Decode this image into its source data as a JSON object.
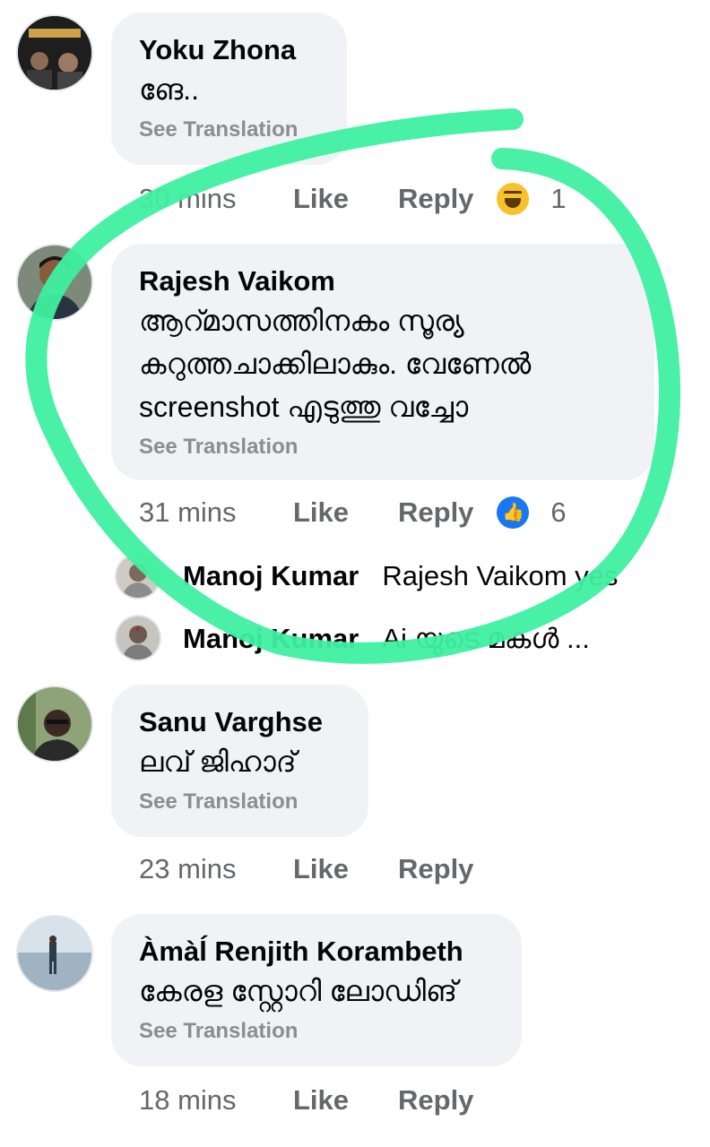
{
  "comments": [
    {
      "author": "Yoku Zhona",
      "text_lines": [
        "ങേ.."
      ],
      "translate": "See Translation",
      "time": "30 mins",
      "like": "Like",
      "reply": "Reply",
      "reaction_icon": "haha-emoji-icon",
      "reaction_count": "1"
    },
    {
      "author": "Rajesh Vaikom",
      "text_lines": [
        "ആറ്മാസത്തിനകം സൂര്യ",
        "കറുത്തചാക്കിലാകും. വേണേൽ",
        "screenshot എടുത്തു വച്ചോ"
      ],
      "translate": "See Translation",
      "time": "31 mins",
      "like": "Like",
      "reply": "Reply",
      "reaction_icon": "like-reaction-icon",
      "reaction_count": "6",
      "replies": [
        {
          "author": "Manoj Kumar",
          "text": "Rajesh Vaikom yes"
        },
        {
          "author": "Manoj Kumar",
          "text": "Ai യുടെ മകൾ ..."
        }
      ]
    },
    {
      "author": "Sanu Varghse",
      "text_lines": [
        "ലവ് ജിഹാദ്"
      ],
      "translate": "See Translation",
      "time": "23 mins",
      "like": "Like",
      "reply": "Reply"
    },
    {
      "author": "Àmàĺ Renjith Korambeth",
      "text_lines": [
        "കേരള സ്റ്റോറി ലോഡിങ്"
      ],
      "translate": "See Translation",
      "time": "18 mins",
      "like": "Like",
      "reply": "Reply"
    }
  ],
  "colors": {
    "bubble": "#f0f2f5",
    "meta_text": "#65676b",
    "translate_text": "#8a8d91",
    "annotation_stroke": "#3ef0a0",
    "like_blue": "#1877f2"
  }
}
